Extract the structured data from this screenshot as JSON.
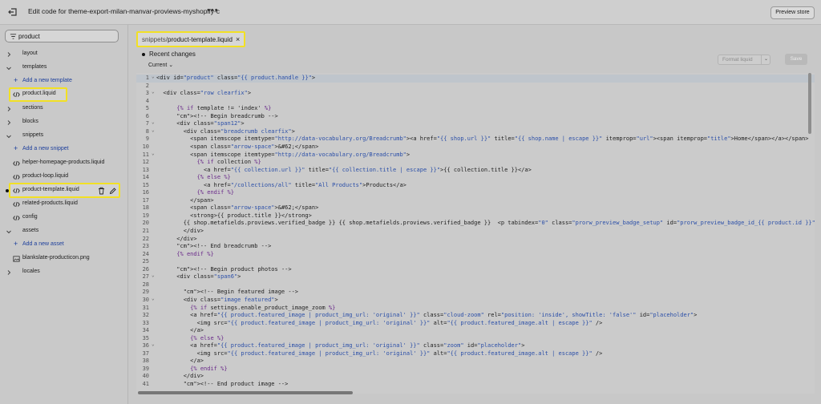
{
  "header": {
    "title": "Edit code for theme-export-milan-manvar-proviews-myshopify-c",
    "more_label": "•••",
    "preview_label": "Preview store"
  },
  "sidebar": {
    "search_value": "product",
    "items": [
      {
        "type": "folder",
        "label": "layout"
      },
      {
        "type": "folder-open",
        "label": "templates"
      },
      {
        "type": "add",
        "label": "Add a new template"
      },
      {
        "type": "file-highlight",
        "label": "product.liquid"
      },
      {
        "type": "folder",
        "label": "sections"
      },
      {
        "type": "folder",
        "label": "blocks"
      },
      {
        "type": "folder-open",
        "label": "snippets"
      },
      {
        "type": "add",
        "label": "Add a new snippet"
      },
      {
        "type": "file",
        "label": "helper-homepage-products.liquid"
      },
      {
        "type": "file",
        "label": "product-loop.liquid"
      },
      {
        "type": "file-active",
        "label": "product-template.liquid"
      },
      {
        "type": "file",
        "label": "related-products.liquid"
      },
      {
        "type": "file",
        "label": "config"
      },
      {
        "type": "folder-open",
        "label": "assets"
      },
      {
        "type": "add",
        "label": "Add a new asset"
      },
      {
        "type": "file-image",
        "label": "blankslate-producticon.png"
      },
      {
        "type": "folder",
        "label": "locales"
      }
    ]
  },
  "tab": {
    "folder": "snippets/",
    "file": "product-template.liquid",
    "close": "×"
  },
  "recent_changes": "Recent changes",
  "current_label": "Current",
  "format_label": "Format liquid",
  "save_label": "Save",
  "code_lines": [
    "<div id=\"product\" class=\"{{ product.handle }}\">",
    "",
    "  <div class=\"row clearfix\">",
    "",
    "      {% if template != 'index' %}",
    "      <!-- Begin breadcrumb -->",
    "      <div class=\"span12\">",
    "        <div class=\"breadcrumb clearfix\">",
    "          <span itemscope itemtype=\"http://data-vocabulary.org/Breadcrumb\"><a href=\"{{ shop.url }}\" title=\"{{ shop.name | escape }}\" itemprop=\"url\"><span itemprop=\"title\">Home</span></a></span>",
    "          <span class=\"arrow-space\">&#62;</span>",
    "          <span itemscope itemtype=\"http://data-vocabulary.org/Breadcrumb\">",
    "            {% if collection %}",
    "              <a href=\"{{ collection.url }}\" title=\"{{ collection.title | escape }}\">{{ collection.title }}</a>",
    "            {% else %}",
    "              <a href=\"/collections/all\" title=\"All Products\">Products</a>",
    "            {% endif %}",
    "          </span>",
    "          <span class=\"arrow-space\">&#62;</span>",
    "          <strong>{{ product.title }}</strong>",
    "        {{ shop.metafields.proviews.verified_badge }} {{ shop.metafields.proviews.verified_badge }}  <p tabindex=\"0\" class=\"prorw_preview_badge_setup\" id=\"prorw_preview_badge_id_{{ product.id }}\" data-",
    "        </div>",
    "      </div>",
    "      <!-- End breadcrumb -->",
    "      {% endif %}",
    "",
    "      <!-- Begin product photos -->",
    "      <div class=\"span6\">",
    "",
    "        <!-- Begin featured image -->",
    "        <div class=\"image featured\">",
    "          {% if settings.enable_product_image_zoom %}",
    "          <a href=\"{{ product.featured_image | product_img_url: 'original' }}\" class=\"cloud-zoom\" rel=\"position: 'inside', showTitle: 'false'\" id=\"placeholder\">",
    "            <img src=\"{{ product.featured_image | product_img_url: 'original' }}\" alt=\"{{ product.featured_image.alt | escape }}\" />",
    "          </a>",
    "          {% else %}",
    "          <a href=\"{{ product.featured_image | product_img_url: 'original' }}\" class=\"zoom\" id=\"placeholder\">",
    "            <img src=\"{{ product.featured_image | product_img_url: 'original' }}\" alt=\"{{ product.featured_image.alt | escape }}\" />",
    "          </a>",
    "          {% endif %}",
    "        </div>",
    "        <!-- End product image -->"
  ],
  "fold_lines": [
    1,
    3,
    7,
    8,
    11,
    27,
    30,
    36
  ],
  "active_line": 1
}
